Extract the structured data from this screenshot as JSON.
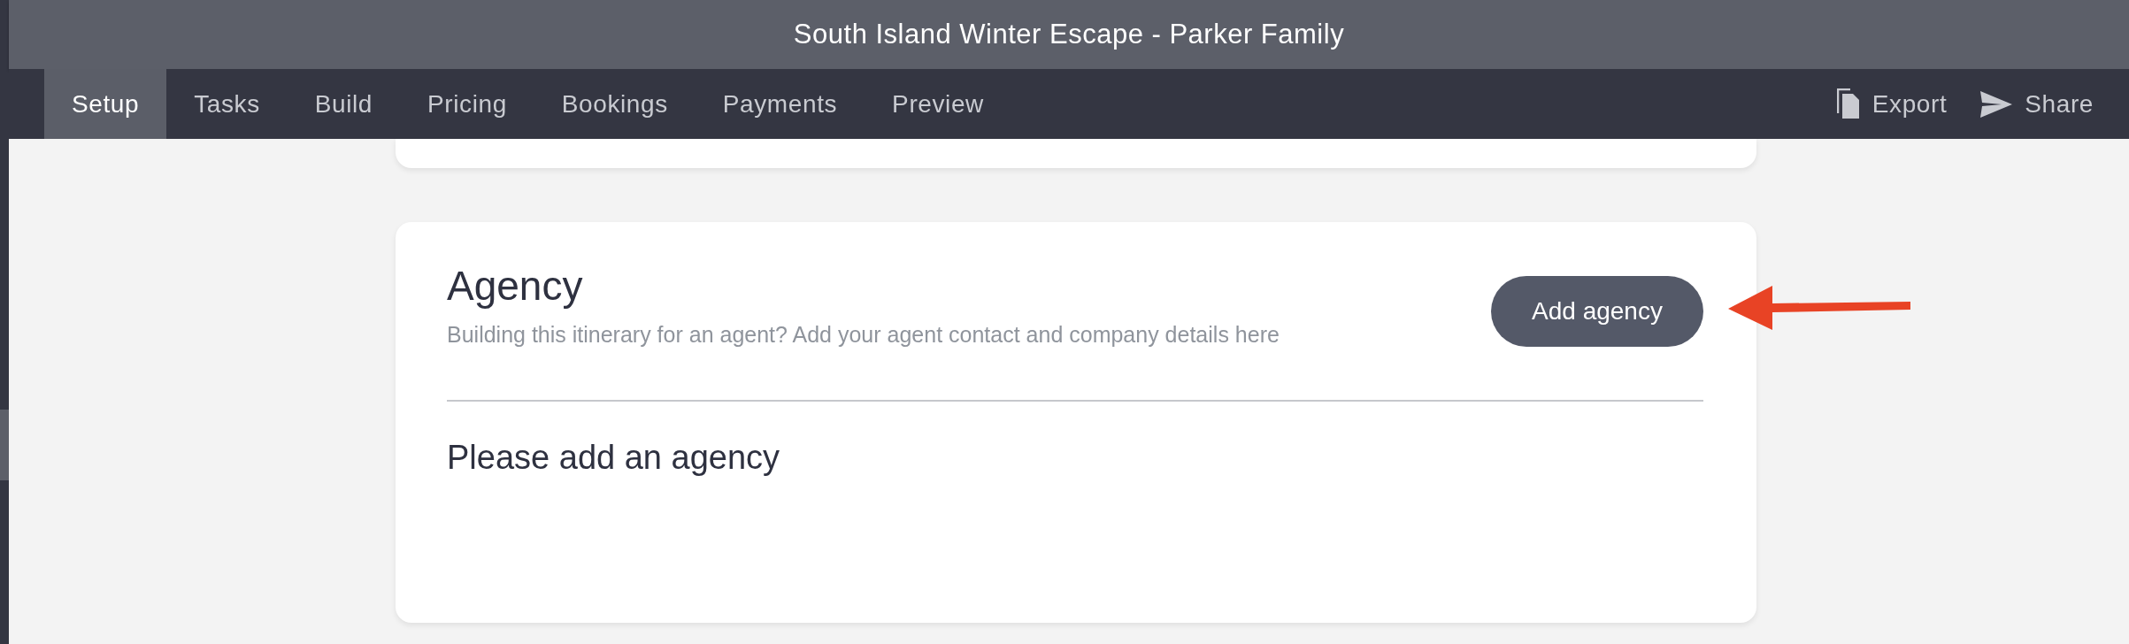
{
  "window": {
    "title": "South Island Winter Escape - Parker Family"
  },
  "tabs": [
    {
      "label": "Setup",
      "selected": true
    },
    {
      "label": "Tasks",
      "selected": false
    },
    {
      "label": "Build",
      "selected": false
    },
    {
      "label": "Pricing",
      "selected": false
    },
    {
      "label": "Bookings",
      "selected": false
    },
    {
      "label": "Payments",
      "selected": false
    },
    {
      "label": "Preview",
      "selected": false
    }
  ],
  "actions": [
    {
      "kind": "export",
      "label": "Export"
    },
    {
      "kind": "share",
      "label": "Share"
    }
  ],
  "agency_card": {
    "title": "Agency",
    "description": "Building this itinerary for an agent? Add your agent contact and company details here",
    "button": "Add agency",
    "empty_message": "Please add an agency"
  }
}
